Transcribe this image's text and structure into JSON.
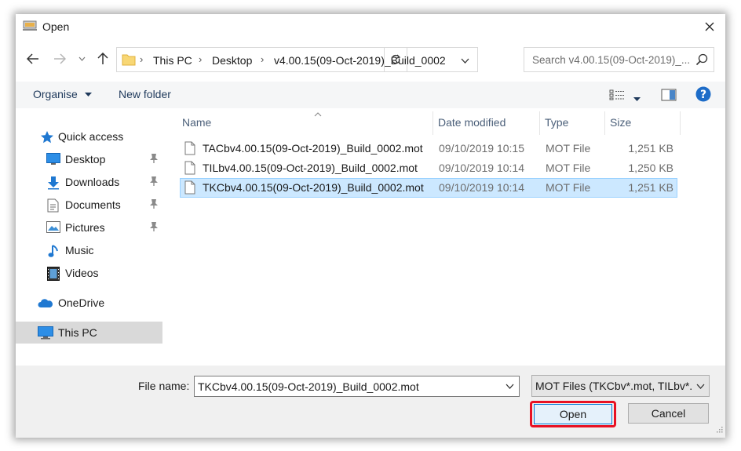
{
  "window": {
    "title": "Open"
  },
  "address": {
    "crumbs": [
      "This PC",
      "Desktop",
      "v4.00.15(09-Oct-2019)_Build_0002"
    ]
  },
  "search": {
    "placeholder": "Search v4.00.15(09-Oct-2019)_..."
  },
  "toolbar": {
    "organise_label": "Organise",
    "new_folder_label": "New folder"
  },
  "nav": {
    "quick_access": "Quick access",
    "items": [
      {
        "label": "Desktop",
        "icon": "desktop-icon",
        "pinned": true
      },
      {
        "label": "Downloads",
        "icon": "downloads-icon",
        "pinned": true
      },
      {
        "label": "Documents",
        "icon": "documents-icon",
        "pinned": true
      },
      {
        "label": "Pictures",
        "icon": "pictures-icon",
        "pinned": true
      },
      {
        "label": "Music",
        "icon": "music-icon",
        "pinned": false
      },
      {
        "label": "Videos",
        "icon": "videos-icon",
        "pinned": false
      }
    ],
    "onedrive": "OneDrive",
    "this_pc": "This PC"
  },
  "columns": {
    "name": "Name",
    "date": "Date modified",
    "type": "Type",
    "size": "Size"
  },
  "files": [
    {
      "name": "TACbv4.00.15(09-Oct-2019)_Build_0002.mot",
      "date": "09/10/2019 10:15",
      "type": "MOT File",
      "size": "1,251 KB",
      "selected": false
    },
    {
      "name": "TILbv4.00.15(09-Oct-2019)_Build_0002.mot",
      "date": "09/10/2019 10:14",
      "type": "MOT File",
      "size": "1,250 KB",
      "selected": false
    },
    {
      "name": "TKCbv4.00.15(09-Oct-2019)_Build_0002.mot",
      "date": "09/10/2019 10:14",
      "type": "MOT File",
      "size": "1,251 KB",
      "selected": true
    }
  ],
  "bottom": {
    "file_name_label": "File name:",
    "file_name_value": "TKCbv4.00.15(09-Oct-2019)_Build_0002.mot",
    "filter_value": "MOT Files (TKCbv*.mot, TILbv*.",
    "open_label": "Open",
    "cancel_label": "Cancel"
  },
  "colors": {
    "selection_bg": "#cce8ff",
    "selection_border": "#99d1ff",
    "highlight_red": "#e81123",
    "accent_blue": "#0078d7"
  }
}
